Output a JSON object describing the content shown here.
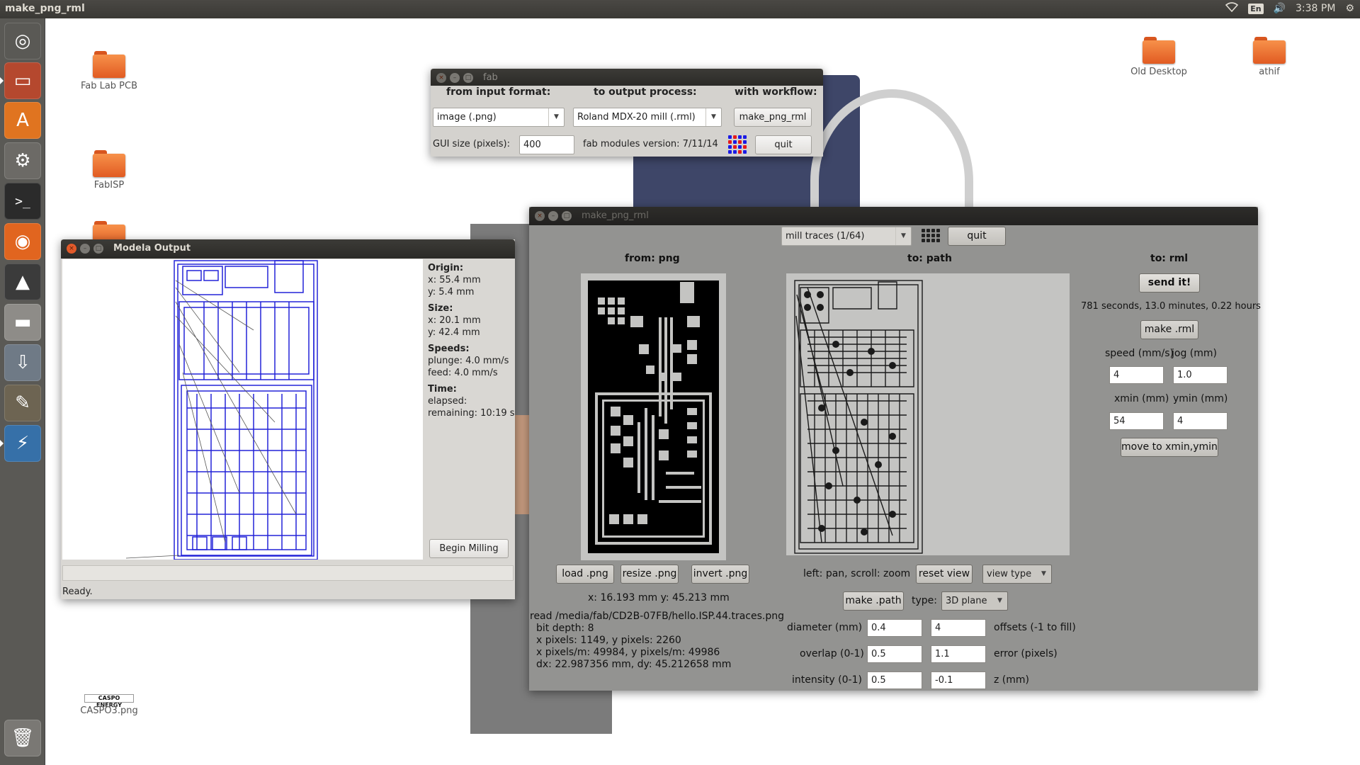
{
  "panel": {
    "app_title": "make_png_rml",
    "keyboard": "En",
    "clock": "3:38 PM"
  },
  "launcher": {
    "items": [
      {
        "name": "dash-home",
        "glyph": "◎",
        "color": "#5a5955"
      },
      {
        "name": "files",
        "glyph": "▭",
        "color": "#b5482e"
      },
      {
        "name": "software-center",
        "glyph": "A",
        "color": "#e07420"
      },
      {
        "name": "system-settings",
        "glyph": "⚙",
        "color": "#6c6a66"
      },
      {
        "name": "terminal",
        "glyph": ">_",
        "color": "#2b2b2b"
      },
      {
        "name": "firefox",
        "glyph": "◉",
        "color": "#e1651f"
      },
      {
        "name": "inkscape",
        "glyph": "▲",
        "color": "#3b3b3b"
      },
      {
        "name": "drive",
        "glyph": "▬",
        "color": "#8e8c88"
      },
      {
        "name": "usb",
        "glyph": "⇩",
        "color": "#6f7a86"
      },
      {
        "name": "gimp",
        "glyph": "✎",
        "color": "#6d6452"
      },
      {
        "name": "python",
        "glyph": "⚡",
        "color": "#3670a8"
      },
      {
        "name": "trash",
        "glyph": "🗑",
        "color": "#7a7874"
      }
    ]
  },
  "desktop": {
    "icons": [
      {
        "label": "Fab Lab PCB"
      },
      {
        "label": "FabISP"
      },
      {
        "label": "Old Desktop"
      },
      {
        "label": "athif"
      },
      {
        "label": "CASPO3.png",
        "thumb_text": "CASPO ENERGY"
      }
    ]
  },
  "fab_window": {
    "title": "fab",
    "from_label": "from input format:",
    "to_label": "to output process:",
    "workflow_label": "with workflow:",
    "input_format": "image (.png)",
    "output_process": "Roland MDX-20 mill (.rml)",
    "workflow": "make_png_rml",
    "gui_size_label": "GUI size (pixels):",
    "gui_size": "400",
    "version": "fab modules version: 7/11/14",
    "quit": "quit"
  },
  "rml_window": {
    "title": "make_png_rml",
    "process": "mill traces (1/64)",
    "quit": "quit",
    "from_label": "from: png",
    "to_path_label": "to: path",
    "to_rml_label": "to: rml",
    "send_it": "send it!",
    "time_estimate": "781 seconds, 13.0 minutes, 0.22 hours",
    "make_rml": "make .rml",
    "speed_label": "speed (mm/s)",
    "jog_label": "jog (mm)",
    "speed": "4",
    "jog": "1.0",
    "xmin_label": "xmin (mm)",
    "ymin_label": "ymin (mm)",
    "xmin": "54",
    "ymin": "4",
    "move_btn": "move to xmin,ymin",
    "load_png": "load .png",
    "resize_png": "resize .png",
    "invert_png": "invert .png",
    "coords": "x: 16.193 mm  y: 45.213 mm",
    "info_lines": [
      "read /media/fab/CD2B-07FB/hello.ISP.44.traces.png",
      "bit depth: 8",
      "x pixels: 1149, y pixels: 2260",
      "x pixels/m: 49984, y pixels/m: 49986",
      "dx: 22.987356 mm, dy: 45.212658 mm"
    ],
    "pan_hint": "left: pan, scroll: zoom",
    "reset_view": "reset view",
    "view_type": "view type",
    "make_path": "make .path",
    "type_label": "type:",
    "type_value": "3D plane",
    "diameter_label": "diameter (mm)",
    "diameter": "0.4",
    "offsets": "4",
    "offsets_label": "offsets (-1 to fill)",
    "overlap_label": "overlap (0-1)",
    "overlap": "0.5",
    "error": "1.1",
    "error_label": "error (pixels)",
    "intensity_label": "intensity (0-1)",
    "intensity": "0.5",
    "z": "-0.1",
    "z_label": "z (mm)"
  },
  "modela_window": {
    "title": "Modela Output",
    "origin_label": "Origin:",
    "origin_x": "x: 55.4 mm",
    "origin_y": "y: 5.4 mm",
    "size_label": "Size:",
    "size_x": "x: 20.1 mm",
    "size_y": "y: 42.4 mm",
    "speeds_label": "Speeds:",
    "plunge": "plunge: 4.0 mm/s",
    "feed": "feed: 4.0 mm/s",
    "time_label": "Time:",
    "elapsed": "elapsed:",
    "remaining": "remaining: 10:19 s",
    "begin_btn": "Begin Milling",
    "status": "Ready."
  }
}
